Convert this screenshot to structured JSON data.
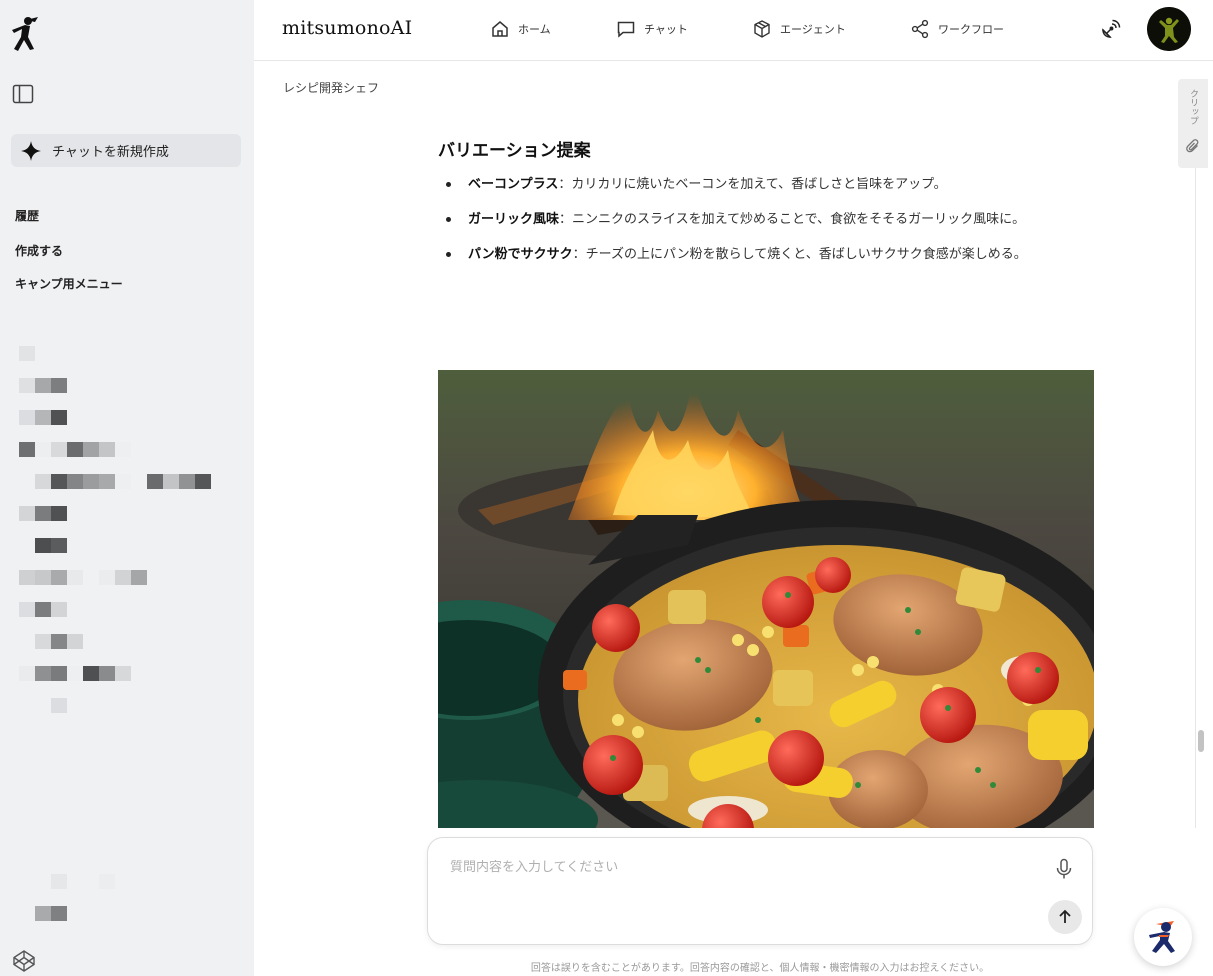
{
  "colors": {
    "sidebar_bg": "#f0f1f3",
    "accent_ninja": "#f0602a",
    "ninja_body": "#1b2a6b"
  },
  "brand": "mitsumonoAI",
  "nav": [
    {
      "label": "ホーム",
      "icon": "home-icon"
    },
    {
      "label": "チャット",
      "icon": "chat-icon"
    },
    {
      "label": "エージェント",
      "icon": "cube-icon"
    },
    {
      "label": "ワークフロー",
      "icon": "share-nodes-icon"
    }
  ],
  "sidebar": {
    "new_chat_label": "チャットを新規作成",
    "history_label": "履歴",
    "items": [
      "作成する",
      "キャンプ用メニュー"
    ]
  },
  "breadcrumb": "レシピ開発シェフ",
  "article": {
    "heading": "バリエーション提案",
    "bullets": [
      {
        "title": "ベーコンプラス",
        "sep": "：",
        "body": "カリカリに焼いたベーコンを加えて、香ばしさと旨味をアップ。"
      },
      {
        "title": "ガーリック風味",
        "sep": "：",
        "body": "ニンニクのスライスを加えて炒めることで、食欲をそそるガーリック風味に。"
      },
      {
        "title": "パン粉でサクサク",
        "sep": "：",
        "body": "チーズの上にパン粉を散らして焼くと、香ばしいサクサク食感が楽しめる。"
      }
    ]
  },
  "clip_label": "クリップ",
  "composer": {
    "placeholder": "質問内容を入力してください",
    "value": ""
  },
  "disclaimer": "回答は誤りを含むことがあります。回答内容の確認と、個人情報・機密情報の入力はお控えください。"
}
